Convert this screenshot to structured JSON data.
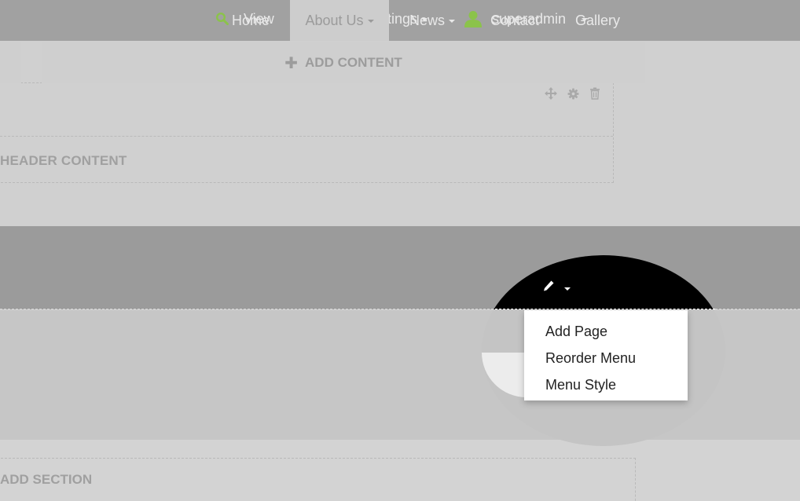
{
  "topbar": {
    "view_label": "View",
    "settings_label": "Site Settings",
    "user_label": "superadmin",
    "icon_color": "#8bc34a"
  },
  "header": {
    "content_label": "HEADER CONTENT",
    "tools": [
      "move-icon",
      "gear-icon",
      "trash-icon"
    ]
  },
  "nav": {
    "items": [
      {
        "label": "Home",
        "has_dropdown": false
      },
      {
        "label": "About Us",
        "has_dropdown": true,
        "active": true
      },
      {
        "label": "News",
        "has_dropdown": true
      },
      {
        "label": "Contact",
        "has_dropdown": false
      },
      {
        "label": "Gallery",
        "has_dropdown": false
      }
    ]
  },
  "edit_menu": {
    "icon": "pencil-icon",
    "items": [
      {
        "label": "Add Page"
      },
      {
        "label": "Reorder Menu"
      },
      {
        "label": "Menu Style"
      }
    ]
  },
  "content": {
    "add_content_label": "ADD CONTENT",
    "add_section_label": "ADD SECTION"
  }
}
